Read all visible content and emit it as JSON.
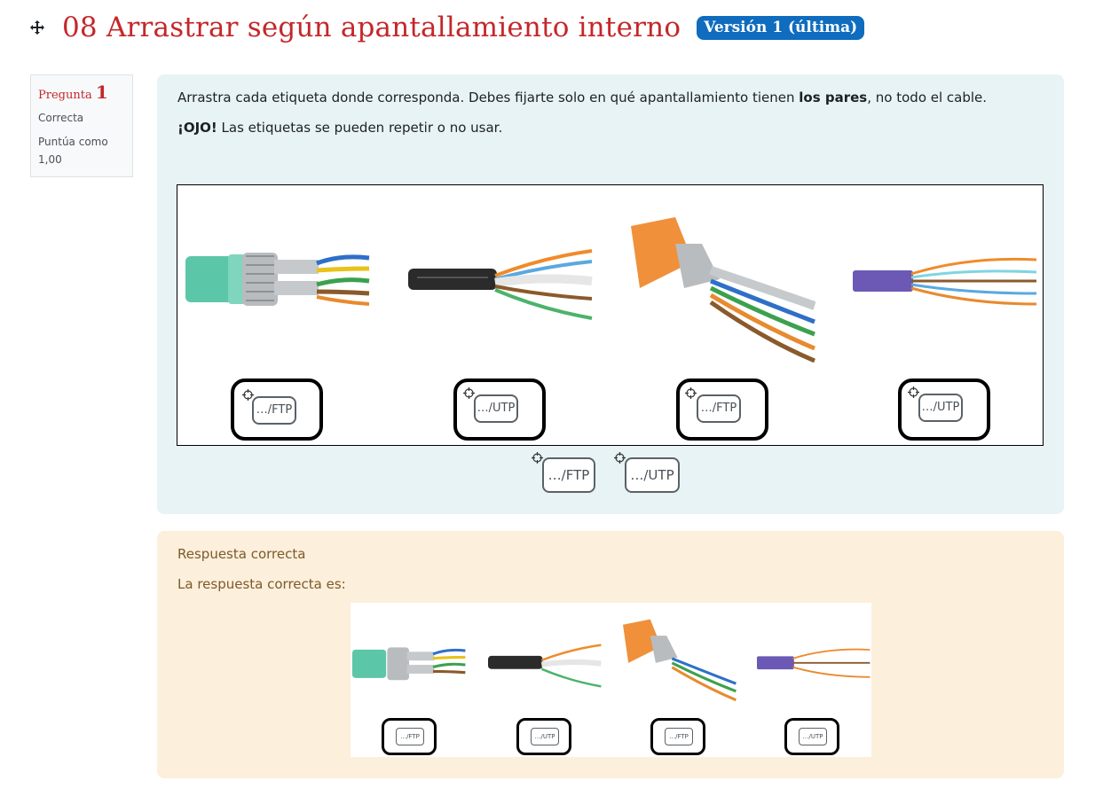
{
  "header": {
    "title": "08 Arrastrar según apantallamiento interno",
    "version_badge": "Versión 1 (última)"
  },
  "info": {
    "question_label": "Pregunta",
    "question_number": "1",
    "status": "Correcta",
    "grade_label": "Puntúa como",
    "grade_value": "1,00"
  },
  "question": {
    "text_before_bold": "Arrastra cada etiqueta donde corresponda. Debes fijarte solo en qué apantallamiento tienen ",
    "text_bold": "los pares",
    "text_after_bold": ", no todo el cable.",
    "warning_bold": "¡OJO!",
    "warning_text": " Las etiquetas se pueden repetir o no usar.",
    "placed_labels": [
      "…/FTP",
      "…/UTP",
      "…/FTP",
      "…/UTP"
    ],
    "pool_labels": [
      "…/FTP",
      "…/UTP"
    ]
  },
  "feedback": {
    "result": "Respuesta correcta",
    "correct_answer_intro": "La respuesta correcta es:",
    "answer_labels": [
      "…/FTP",
      "…/UTP",
      "…/FTP",
      "…/UTP"
    ]
  },
  "colors": {
    "title": "#c4272a",
    "badge": "#0f6cbf",
    "question_bg": "#e7f3f5",
    "feedback_bg": "#fcefdc"
  }
}
